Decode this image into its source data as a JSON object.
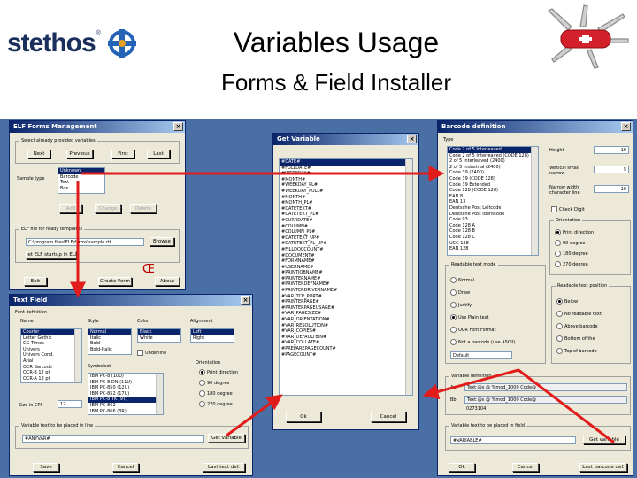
{
  "slide": {
    "logo_text": "stethos",
    "logo_reg": "®",
    "title": "Variables Usage",
    "subtitle": "Forms & Field Installer"
  },
  "forms_manager": {
    "title": "ELF Forms Management",
    "select_group": "Select already provided variables",
    "buttons": {
      "next": "Next",
      "previous": "Previous",
      "first": "First",
      "last": "Last"
    },
    "sample_type_label": "Sample type",
    "sample_types": [
      "Unknown",
      "Barcode",
      "Text",
      "Box"
    ],
    "add": "Add",
    "change": "Change",
    "delete": "Delete",
    "file_group": "ELF file for ready templates",
    "file_path": "C:\\program files\\ELF\\forms\\sample.rtf",
    "browse": "Browse",
    "set_startup": "Set ELF startup in ELF",
    "exit": "Exit",
    "create_form": "Create Form",
    "about": "About",
    "symbol": "Œ"
  },
  "get_variable": {
    "title": "Get Variable",
    "items": [
      "#DATE#",
      "#FULLDATE#",
      "#WEEKDAY#",
      "#MONTH#",
      "#WEEKDAY_PL#",
      "#WEEKDAY_FULL#",
      "#MONTH#",
      "#MONTH_PL#",
      "#DATETEXT#",
      "#DATETEXT_PL#",
      "#CURRDATE#",
      "#COLUMN#",
      "#COLUMN_PL#",
      "#DATETEXT_UP#",
      "#DATETEXT_PL_UP#",
      "#FILLDOCCOUNT#",
      "#DOCUMENT#",
      "#FORMNAME#",
      "#USERNAME#",
      "#PRINTJOBNAME#",
      "#PRINTERNAME#",
      "#PRINTERDEFNAME#",
      "#PRINTERDRIVERNAME#",
      "#VAR_TCP_PORT#",
      "#PRINTERPAGE#",
      "#PRINTERPAGEUSAGE#",
      "#VAR_PAGESIZE#",
      "#VAR_ORIENTATION#",
      "#VAR_RESOLUTION#",
      "#VAR_COPIES#",
      "#VAR_DEFAULTBIN#",
      "#VAR_COLLATE#",
      "#PREPAREPAGECOUNT#",
      "#PAGECOUNT#"
    ],
    "ok": "Ok",
    "cancel": "Cancel"
  },
  "barcode_def": {
    "title": "Barcode definition",
    "type_group": "Type",
    "types": [
      "Code 2 of 5 Interleaved",
      "Code 2 of 5 Interleaved (CODE 128)",
      "2 of 5 Interleaved (2400)",
      "2 of 5 Industrial (2400)",
      "Code 39 (2400)",
      "Code 39 (CODE 128)",
      "Code 39 Extended",
      "Code 128 (CODE 128)",
      "EAN 8",
      "EAN 13",
      "Deutsche Post Leitcode",
      "Deutsche Post Identcode",
      "Code 93",
      "Code 128 A",
      "Code 128 B",
      "Code 128 C",
      "UCC 128",
      "EAN 128"
    ],
    "height_label": "Height",
    "height_val": "10",
    "spacing_label": "Vertical small narrow",
    "spacing_val": "5",
    "ratio_label": "Narrow width character line",
    "ratio_val": "10",
    "check_digit": "Check Digit",
    "orientation_group": "Orientation",
    "orientations": [
      "Print direction",
      "90 degree",
      "180 degree",
      "270 degree"
    ],
    "readable_group": "Readable text mode",
    "readable_modes": [
      "Normal",
      "Draw",
      "Justify",
      "Use Plain text",
      "OCR Font Format",
      "Not a barcode (use ASCII)"
    ],
    "readable_select": "Default",
    "position_group": "Readable text position",
    "positions": [
      "Below",
      "No readable text",
      "Above barcode",
      "Bottom of the",
      "Top of barcode"
    ],
    "def_group": "Variable definition",
    "def_a_label": "Aa",
    "def_a_val": "Text:@s @ %mod_1000 Code@",
    "def_b_label": "Bb",
    "def_b_val": "Text:@s @ %mod_1000 Code@",
    "def_count": "0273104",
    "var_text_label": "Variable text to be placed in field",
    "var_text_val": "#VARIABLE#",
    "get_variable": "Get variable",
    "ok": "Ok",
    "cancel": "Cancel",
    "last_barcode": "Last barcode def."
  },
  "text_field": {
    "title": "Text Field",
    "font_group": "Font definition",
    "name_label": "Name",
    "style_label": "Style",
    "color_label": "Color",
    "align_label": "Alignment",
    "fonts": [
      "Courier",
      "Letter Gothic",
      "CG Times",
      "Univers",
      "Univers Cond.",
      "Arial",
      "OCR Barcode",
      "OCR-B 12 pt",
      "OCR-A 12 pt"
    ],
    "styles": [
      "Normal",
      "Italic",
      "Bold",
      "Bold-Italic"
    ],
    "colors": [
      "Black",
      "White"
    ],
    "aligns": [
      "Left",
      "Right"
    ],
    "underline": "Underline",
    "symbolset_label": "Symbolset",
    "symbolsets": [
      "IBM PC-8 (10U)",
      "IBM PC-8 DN (11U)",
      "IBM PC-850 (12U)",
      "IBM PC-852 (17U)",
      "IBM PC-8 TK (9T)",
      "IBM PC-862",
      "IBM PC-866 (3R)"
    ],
    "orientation_label": "Orientation",
    "orientations": [
      "Print direction",
      "90 degree",
      "180 degree",
      "270 degree"
    ],
    "size_label": "Size in CPI",
    "size_val": "12",
    "var_text_label": "Variable text to be placed in line",
    "var_text_val": "#ANYVAR#",
    "get_variable": "Get variable",
    "save": "Save",
    "cancel": "Cancel",
    "last_text": "Last text def."
  },
  "colors": {
    "background": "#4a6fa5",
    "arrow": "#e21b1b",
    "title_bar": "#0a246a"
  }
}
